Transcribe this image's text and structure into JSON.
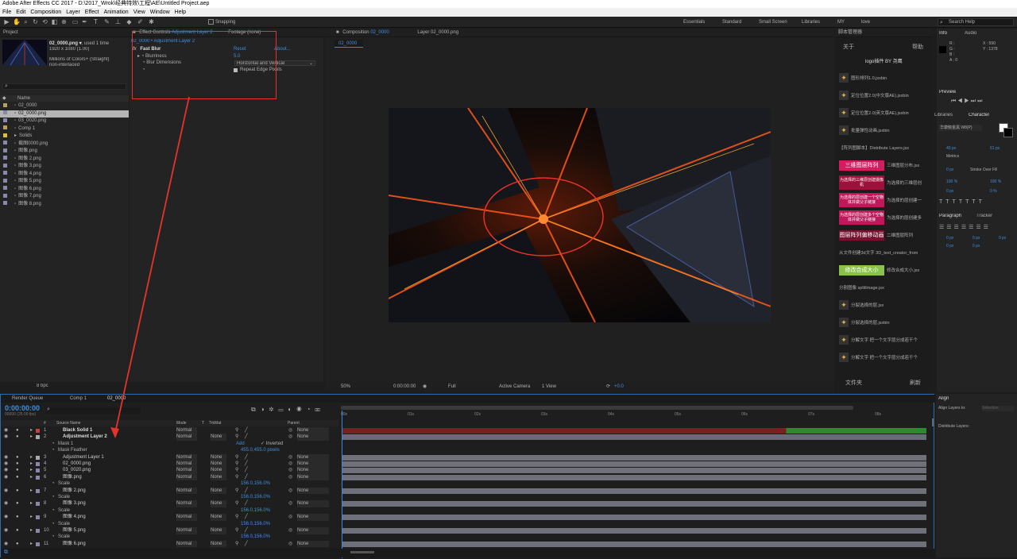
{
  "window": {
    "title": "Adobe After Effects CC 2017 - D:\\2017_Wrok\\经典特效\\工程\\AE\\Untitled Project.aep"
  },
  "menu": [
    "File",
    "Edit",
    "Composition",
    "Layer",
    "Effect",
    "Animation",
    "View",
    "Window",
    "Help"
  ],
  "toolbar": {
    "snapping": "Snapping",
    "workspaces": [
      "Essentials",
      "Standard",
      "Small Screen",
      "Libraries",
      "MY",
      "love"
    ],
    "search_placeholder": "Search Help"
  },
  "project": {
    "tab": "Project",
    "item_name": "02_0000.png ▾",
    "item_used": ", used 1 time",
    "item_size": "1920 x 1080 (1.00)",
    "item_colors": "Millions of Colors+ (Straight)",
    "item_interlace": "non-interlaced",
    "col_name": "Name",
    "items": [
      {
        "name": "02_0000",
        "color": "#b8a060"
      },
      {
        "name": "02_0000.png",
        "color": "#8888aa",
        "selected": true
      },
      {
        "name": "03_0020.png",
        "color": "#8888aa"
      },
      {
        "name": "Comp 1",
        "color": "#b8a060"
      },
      {
        "name": "Solids",
        "color": "#d8c040",
        "folder": true
      },
      {
        "name": "截图0000.png",
        "color": "#8888aa"
      },
      {
        "name": "图像.png",
        "color": "#8888aa"
      },
      {
        "name": "图像 2.png",
        "color": "#8888aa"
      },
      {
        "name": "图像 3.png",
        "color": "#8888aa"
      },
      {
        "name": "图像 4.png",
        "color": "#8888aa"
      },
      {
        "name": "图像 5.png",
        "color": "#8888aa"
      },
      {
        "name": "图像 6.png",
        "color": "#8888aa"
      },
      {
        "name": "图像 7.png",
        "color": "#8888aa"
      },
      {
        "name": "图像 8.png",
        "color": "#8888aa"
      }
    ],
    "bpc": "8 bpc"
  },
  "effect_controls": {
    "tab_prefix": "Effect Controls",
    "tab_layer": "Adjustment Layer 2",
    "footage_tab": "Footage (none)",
    "breadcrumb": "02_0000 • Adjustment Layer 2",
    "effect_name": "Fast Blur",
    "reset": "Reset",
    "about": "About...",
    "blurriness_label": "Blurriness",
    "blurriness_value": "5.0",
    "dimensions_label": "Blur Dimensions",
    "dimensions_value": "Horizontal and Vertical",
    "repeat_label": "Repeat Edge Pixels"
  },
  "composition": {
    "tab_prefix": "Composition",
    "tab_name": "02_0000",
    "layer_tab": "Layer 02_0000.png",
    "sub_tab": "02_0000",
    "zoom": "50%",
    "timecode": "0:00:00:00",
    "resolution": "Full",
    "camera": "Active Camera",
    "view": "1 View",
    "exposure": "+0.0"
  },
  "scripts": {
    "title": "脚本管理器",
    "about": "关于",
    "help": "帮助",
    "subtitle": "logo插件 BY 尧鹰",
    "items": [
      {
        "label": "图形排列1.0.jsxbin",
        "style": "icon"
      },
      {
        "label": "定位位置2.0(中文版AE).jsxbin",
        "style": "icon"
      },
      {
        "label": "定位位置2.0(英文版AE).jsxbin",
        "style": "icon"
      },
      {
        "label": "批量弹性动画.jsxbin",
        "style": "icon"
      },
      {
        "label": "Distribute Layers.jsx",
        "prefix": "【阵列图脚本】",
        "style": "text"
      },
      {
        "chip": "三维图层阵列",
        "chip_color": "#d81b60",
        "label": "三维图层分布.jsx",
        "style": "chip"
      },
      {
        "chip": "为选择的三维层创建摄像机",
        "chip_color": "#a0103c",
        "label": "为选择的三维层创",
        "style": "chip2"
      },
      {
        "chip": "为选择的层创建一个空物体并做父子链接",
        "chip_color": "#c2185b",
        "label": "为选择的层创建一",
        "style": "chip2"
      },
      {
        "chip": "为选择的层创建多个空物体并做父子链接",
        "chip_color": "#c2185b",
        "label": "为选择的层创建多",
        "style": "chip2"
      },
      {
        "chip": "图层阵列偏移动画",
        "chip_color": "#7a1030",
        "label": "二维图层阵列",
        "style": "chip"
      },
      {
        "label": "从文件创建3d文字 3D_text_creator_from",
        "style": "text"
      },
      {
        "chip": "修改合成大小",
        "chip_color": "#8bc34a",
        "label": "修改合成大小.jsx",
        "style": "chip"
      },
      {
        "label": "分割图像 splitImage.jsx",
        "style": "text"
      },
      {
        "label": "分裂选择的层.jsx",
        "style": "icon"
      },
      {
        "label": "分裂选择的层.jsxbin",
        "style": "icon"
      },
      {
        "label": "分解文字 把一个文字层分成若干个",
        "style": "icon"
      },
      {
        "label": "分解文字 把一个文字层分成若干个",
        "style": "icon"
      }
    ],
    "footer_left": "文件夹",
    "footer_right": "刷新"
  },
  "info": {
    "tab": "Info",
    "audio_tab": "Audio",
    "r": "R :",
    "g": "G :",
    "b": "B :",
    "a": "A : 0",
    "x": "X : 590",
    "y": "Y : 1378"
  },
  "preview": {
    "title": "Preview"
  },
  "character": {
    "libraries_tab": "Libraries",
    "tab": "Character",
    "font": "华康俪金黑 W8(P)",
    "size": "40 px",
    "leading": "61 px",
    "tracking": "100 %",
    "tracking2": "100 %",
    "metrics": "Metrics",
    "stroke_width": "0 px",
    "stroke_mode": "Stroke Over Fill",
    "baseline": "0 px",
    "tsume": "0 %"
  },
  "paragraph": {
    "tab": "Paragraph",
    "tracker_tab": "Tracker",
    "indent": [
      "0 px",
      "0 px",
      "0 px",
      "0 px",
      "0 px"
    ]
  },
  "align": {
    "title": "Align",
    "align_to": "Align Layers to:",
    "selection": "Selection",
    "distribute": "Distribute Layers:"
  },
  "timeline": {
    "tabs": [
      "Render Queue",
      "Comp 1",
      "02_0000"
    ],
    "timecode": "0:00:00:00",
    "fps": "00000 (25.00 fps)",
    "headers": {
      "num": "#",
      "source": "Source Name",
      "mode": "Mode",
      "t": "T",
      "trkmat": "TrkMat",
      "parent": "Parent"
    },
    "ruler": [
      "00s",
      "01s",
      "02s",
      "03s",
      "04s",
      "05s",
      "06s",
      "07s",
      "08s"
    ],
    "rows": [
      {
        "type": "layer",
        "num": "1",
        "name": "Black Solid 1",
        "color": "#c84040",
        "mode": "Normal",
        "trk": "",
        "parent": "None",
        "bar": "#7a2020",
        "bold": true
      },
      {
        "type": "layer",
        "num": "2",
        "name": "Adjustment Layer 2",
        "color": "#aaaaaa",
        "mode": "Normal",
        "trk": "None",
        "parent": "None",
        "bar": "#6a6a78",
        "bold": true
      },
      {
        "type": "sub",
        "name": "Mask 1",
        "value": "Add",
        "extra": "Inverted"
      },
      {
        "type": "sub",
        "name": "Mask Feather",
        "value": "455.0,455.0 pixels"
      },
      {
        "type": "layer",
        "num": "3",
        "name": "Adjustment Layer 1",
        "color": "#aaaaaa",
        "mode": "Normal",
        "trk": "None",
        "parent": "None",
        "bar": "#70707a"
      },
      {
        "type": "layer",
        "num": "4",
        "name": "02_0000.png",
        "color": "#8888aa",
        "mode": "Normal",
        "trk": "None",
        "parent": "None",
        "bar": "#70707a"
      },
      {
        "type": "layer",
        "num": "5",
        "name": "03_0020.png",
        "color": "#8888aa",
        "mode": "Normal",
        "trk": "None",
        "parent": "None",
        "bar": "#70707a"
      },
      {
        "type": "layer",
        "num": "6",
        "name": "图像.png",
        "color": "#8888aa",
        "mode": "Normal",
        "trk": "None",
        "parent": "None",
        "bar": "#70707a"
      },
      {
        "type": "sub",
        "name": "Scale",
        "value": "156.0,156.0%"
      },
      {
        "type": "layer",
        "num": "7",
        "name": "图像 2.png",
        "color": "#8888aa",
        "mode": "Normal",
        "trk": "None",
        "parent": "None",
        "bar": "#70707a"
      },
      {
        "type": "sub",
        "name": "Scale",
        "value": "156.0,156.0%"
      },
      {
        "type": "layer",
        "num": "8",
        "name": "图像 3.png",
        "color": "#8888aa",
        "mode": "Normal",
        "trk": "None",
        "parent": "None",
        "bar": "#70707a"
      },
      {
        "type": "sub",
        "name": "Scale",
        "value": "156.0,156.0%"
      },
      {
        "type": "layer",
        "num": "9",
        "name": "图像 4.png",
        "color": "#8888aa",
        "mode": "Normal",
        "trk": "None",
        "parent": "None",
        "bar": "#70707a"
      },
      {
        "type": "sub",
        "name": "Scale",
        "value": "156.0,156.0%"
      },
      {
        "type": "layer",
        "num": "10",
        "name": "图像 5.png",
        "color": "#8888aa",
        "mode": "Normal",
        "trk": "None",
        "parent": "None",
        "bar": "#70707a"
      },
      {
        "type": "sub",
        "name": "Scale",
        "value": "156.0,156.0%"
      },
      {
        "type": "layer",
        "num": "11",
        "name": "图像 6.png",
        "color": "#8888aa",
        "mode": "Normal",
        "trk": "None",
        "parent": "None",
        "bar": "#70707a"
      }
    ]
  },
  "colors": {
    "accent": "#2d8ceb",
    "annotation": "#e5332a",
    "panel": "#232323",
    "selected": "#a8a8a8"
  }
}
